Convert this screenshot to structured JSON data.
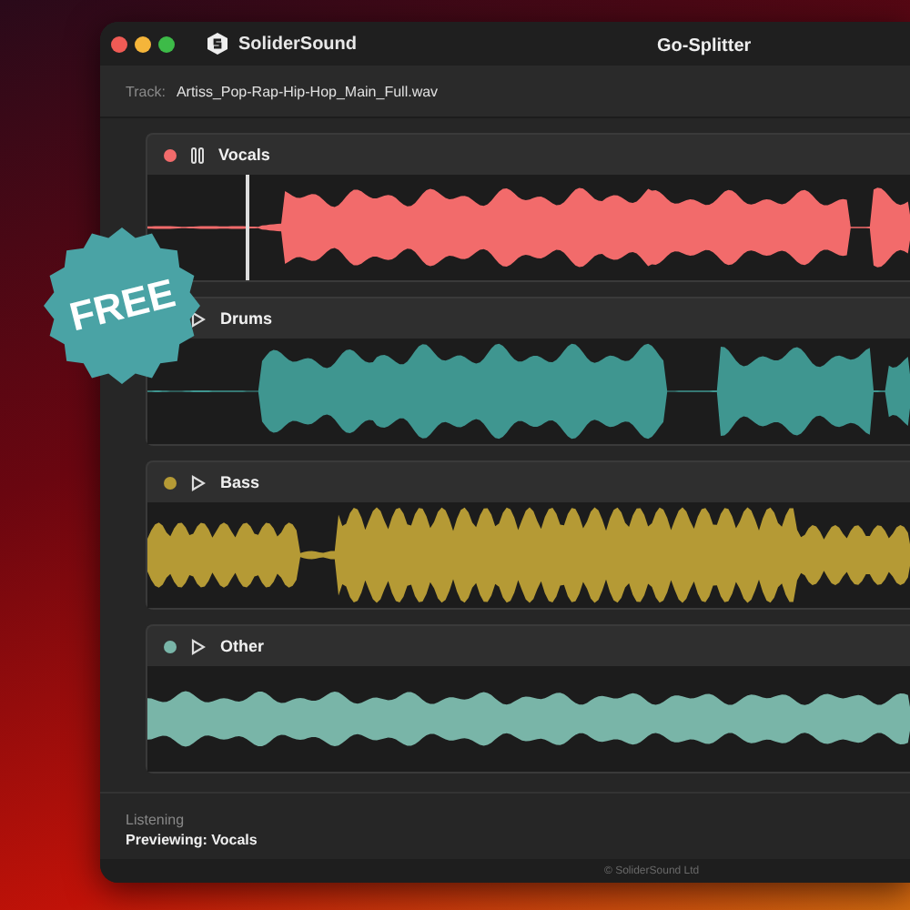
{
  "window": {
    "brand": "SoliderSound",
    "title": "Go-Splitter"
  },
  "track": {
    "label": "Track:",
    "file": "Artiss_Pop-Rap-Hip-Hop_Main_Full.wav"
  },
  "stems": [
    {
      "name": "Vocals",
      "color": "#f26b6b",
      "playing": true
    },
    {
      "name": "Drums",
      "color": "#3f9690",
      "playing": false
    },
    {
      "name": "Bass",
      "color": "#b59a35",
      "playing": false
    },
    {
      "name": "Other",
      "color": "#79b5a8",
      "playing": false
    }
  ],
  "badge": "FREE",
  "status": {
    "label": "Listening",
    "value": "Previewing: Vocals"
  },
  "footer": "© SoliderSound Ltd"
}
